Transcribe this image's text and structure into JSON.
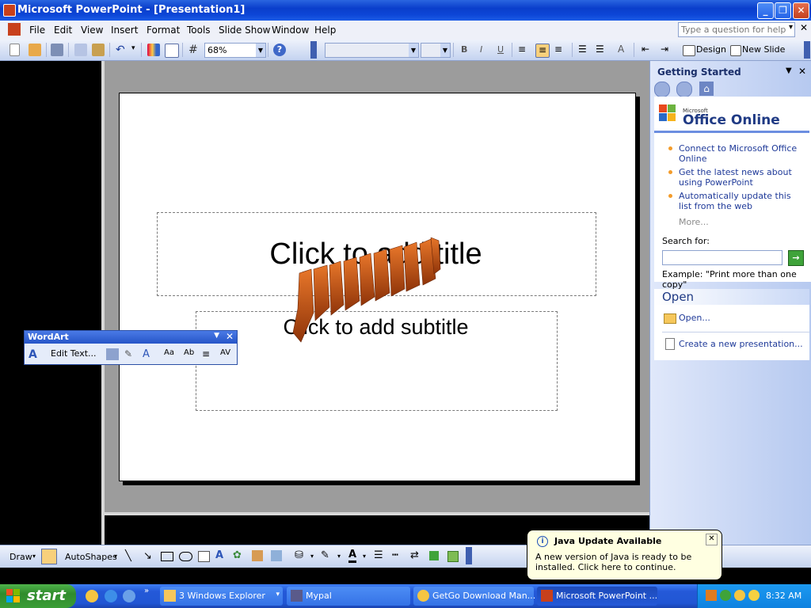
{
  "window": {
    "title": "Microsoft PowerPoint - [Presentation1]"
  },
  "menu": [
    "File",
    "Edit",
    "View",
    "Insert",
    "Format",
    "Tools",
    "Slide Show",
    "Window",
    "Help"
  ],
  "help_box": {
    "placeholder": "Type a question for help"
  },
  "toolbar": {
    "zoom": "68%",
    "design_label": "Design",
    "new_slide_label": "New Slide",
    "bold": "B",
    "italic": "I",
    "underline": "U"
  },
  "slide": {
    "title_placeholder": "Click to add title",
    "subtitle_placeholder": "Click to add subtitle",
    "wordart_color": "#c8541a"
  },
  "wordart_toolbar": {
    "title": "WordArt",
    "edit_text": "Edit Text..."
  },
  "task_pane": {
    "title": "Getting Started",
    "logo_small": "Microsoft",
    "logo": "Office Online",
    "links": [
      "Connect to Microsoft Office Online",
      "Get the latest news about using PowerPoint",
      "Automatically update this list from the web"
    ],
    "more": "More...",
    "search_label": "Search for:",
    "example": "Example:  \"Print more than one copy\"",
    "open_heading": "Open",
    "open_link": "Open...",
    "create_link": "Create a new presentation..."
  },
  "draw_toolbar": {
    "draw_label": "Draw",
    "autoshapes_label": "AutoShapes"
  },
  "taskbar": {
    "start": "start",
    "buttons": [
      "3 Windows Explorer",
      "Mypal",
      "GetGo Download Man...",
      "Microsoft PowerPoint ..."
    ],
    "clock": "8:32 AM"
  },
  "balloon": {
    "title": "Java Update Available",
    "body": "A new version of Java is ready to be installed. Click here to continue."
  }
}
